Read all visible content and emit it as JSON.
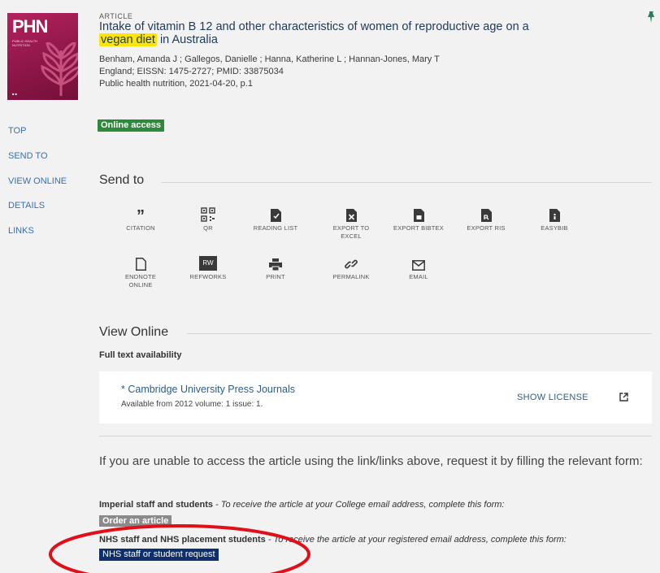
{
  "record": {
    "type": "ARTICLE",
    "title_before": "Intake of vitamin B 12 and other characteristics of women of reproductive age on a ",
    "title_highlight": "vegan diet",
    "title_after": " in Australia",
    "authors": "Benham, Amanda J ; Gallegos, Danielle ; Hanna, Katherine L ; Hannan-Jones, Mary T",
    "identifiers": "England; EISSN: 1475-2727; PMID: 33875034",
    "source": "Public health nutrition, 2021-04-20, p.1",
    "access_badge": "Online access"
  },
  "thumbnail": {
    "logo": "PHN",
    "subtitle": "PUBLIC HEALTH NUTRITION"
  },
  "nav": [
    "TOP",
    "SEND TO",
    "VIEW ONLINE",
    "DETAILS",
    "LINKS"
  ],
  "send_to": {
    "heading": "Send to",
    "actions": [
      {
        "label": "CITATION",
        "icon": "quote-icon"
      },
      {
        "label": "QR",
        "icon": "qr-code-icon"
      },
      {
        "label": "READING LIST",
        "icon": "document-icon"
      },
      {
        "label": "EXPORT TO EXCEL",
        "icon": "excel-icon"
      },
      {
        "label": "EXPORT BIBTEX",
        "icon": "bibtex-icon"
      },
      {
        "label": "EXPORT RIS",
        "icon": "ris-icon"
      },
      {
        "label": "EASYBIB",
        "icon": "easybib-icon"
      },
      {
        "label": "ENDNOTE ONLINE",
        "icon": "endnote-icon"
      },
      {
        "label": "REFWORKS",
        "icon": "refworks-icon"
      },
      {
        "label": "PRINT",
        "icon": "print-icon"
      },
      {
        "label": "PERMALINK",
        "icon": "link-icon"
      },
      {
        "label": "EMAIL",
        "icon": "email-icon"
      }
    ]
  },
  "view_online": {
    "heading": "View Online",
    "full_text_label": "Full text availability",
    "source_name": "* Cambridge University Press Journals",
    "availability": "Available from 2012 volume: 1 issue: 1.",
    "show_license": "SHOW LICENSE"
  },
  "request": {
    "intro": "If you are unable to access the article using the link/links above, request it by filling the relevant form:",
    "imperial_bold": "Imperial staff and students",
    "imperial_text": " - To receive the article at your College email address, complete this form:",
    "imperial_button": "Order an article",
    "nhs_bold": "NHS staff and NHS placement students",
    "nhs_text": " - To receive the article at your registered email address, complete this form:",
    "nhs_button": "NHS staff or student request"
  },
  "colors": {
    "accent": "#3b6eb0",
    "online_badge": "#2e8a3a",
    "nhs_button": "#0e2f6a",
    "highlight": "#ffe600",
    "annotation_ring": "#e0101b"
  }
}
